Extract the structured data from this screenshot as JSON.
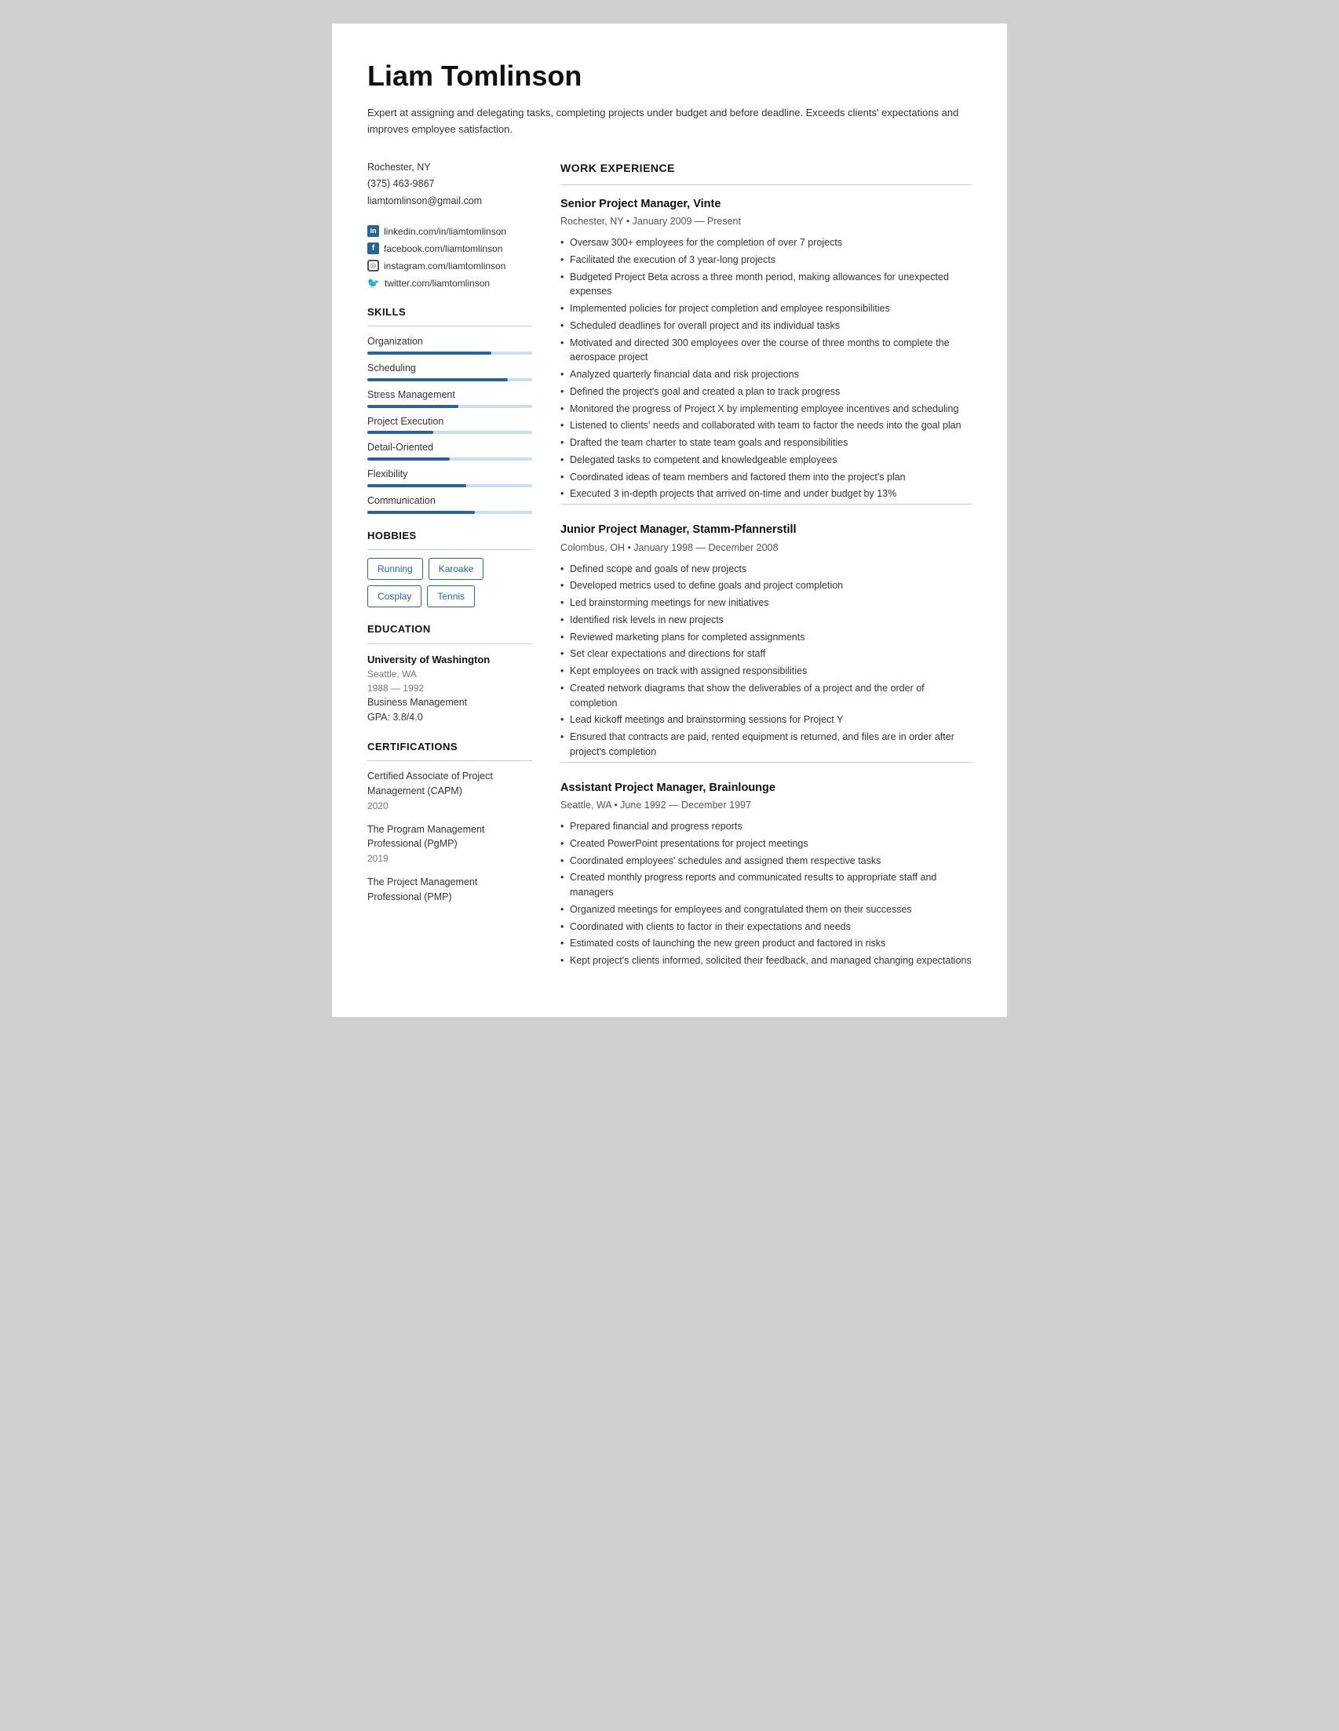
{
  "header": {
    "name": "Liam Tomlinson",
    "summary": "Expert at assigning and delegating tasks, completing projects under budget and before deadline. Exceeds clients' expectations and improves employee satisfaction."
  },
  "contact": {
    "location": "Rochester, NY",
    "phone": "(375) 463-9867",
    "email": "liamtomlinson@gmail.com",
    "linkedin": "linkedin.com/in/liamtomlinson",
    "facebook": "facebook.com/liamtomlinson",
    "instagram": "instagram.com/liamtomlinson",
    "twitter": "twitter.com/liamtomlinson"
  },
  "skills": {
    "section_title": "SKILLS",
    "items": [
      {
        "name": "Organization",
        "level": 75
      },
      {
        "name": "Scheduling",
        "level": 85
      },
      {
        "name": "Stress Management",
        "level": 55
      },
      {
        "name": "Project Execution",
        "level": 40
      },
      {
        "name": "Detail-Oriented",
        "level": 50
      },
      {
        "name": "Flexibility",
        "level": 60
      },
      {
        "name": "Communication",
        "level": 65
      }
    ]
  },
  "hobbies": {
    "section_title": "HOBBIES",
    "items": [
      "Running",
      "Karoake",
      "Cosplay",
      "Tennis"
    ]
  },
  "education": {
    "section_title": "EDUCATION",
    "entries": [
      {
        "school": "University of Washington",
        "location": "Seattle, WA",
        "years": "1988 — 1992",
        "field": "Business Management",
        "gpa": "GPA: 3.8/4.0"
      }
    ]
  },
  "certifications": {
    "section_title": "CERTIFICATIONS",
    "entries": [
      {
        "name": "Certified Associate of Project Management (CAPM)",
        "year": "2020"
      },
      {
        "name": "The Program Management Professional (PgMP)",
        "year": "2019"
      },
      {
        "name": "The Project Management Professional (PMP)",
        "year": ""
      }
    ]
  },
  "work_experience": {
    "section_title": "WORK EXPERIENCE",
    "jobs": [
      {
        "title": "Senior Project Manager, Vinte",
        "meta": "Rochester, NY • January 2009 — Present",
        "bullets": [
          "Oversaw 300+ employees for the completion of over 7 projects",
          "Facilitated the execution of 3 year-long projects",
          "Budgeted Project Beta across a three month period, making allowances for unexpected expenses",
          "Implemented policies for project completion and employee responsibilities",
          "Scheduled deadlines for overall project and its individual tasks",
          "Motivated and directed 300 employees over the course of three months to complete the aerospace project",
          "Analyzed quarterly financial data and risk projections",
          "Defined the project's goal and created a plan to track progress",
          "Monitored the progress of Project X by implementing employee incentives and scheduling",
          "Listened to clients' needs and collaborated with team to factor the needs into the goal plan",
          "Drafted the team charter to state team goals and responsibilities",
          "Delegated tasks to competent and knowledgeable employees",
          "Coordinated ideas of team members and factored them into the project's plan",
          "Executed 3 in-depth projects that arrived on-time and under budget by 13%"
        ]
      },
      {
        "title": "Junior Project Manager, Stamm-Pfannerstill",
        "meta": "Colombus, OH • January 1998 — December 2008",
        "bullets": [
          "Defined scope and goals of new projects",
          "Developed metrics used to define goals and project completion",
          "Led brainstorming meetings for new initiatives",
          "Identified risk levels in new projects",
          "Reviewed marketing plans for completed assignments",
          "Set clear expectations and directions for staff",
          "Kept employees on track with assigned responsibilities",
          "Created network diagrams that show the deliverables of a project and the order of completion",
          "Lead kickoff meetings and brainstorming sessions for Project Y",
          "Ensured that contracts are paid, rented equipment is returned, and files are in order after project's completion"
        ]
      },
      {
        "title": "Assistant Project Manager, Brainlounge",
        "meta": "Seattle, WA • June 1992 — December 1997",
        "bullets": [
          "Prepared financial and progress reports",
          "Created PowerPoint presentations for project meetings",
          "Coordinated employees' schedules and assigned them respective tasks",
          "Created monthly progress reports and communicated results to appropriate staff and managers",
          "Organized meetings for employees and congratulated them on their successes",
          "Coordinated with clients to factor in their expectations and needs",
          "Estimated costs of launching the new green product and factored in risks",
          "Kept project's clients informed, solicited their feedback, and managed changing expectations"
        ]
      }
    ]
  }
}
